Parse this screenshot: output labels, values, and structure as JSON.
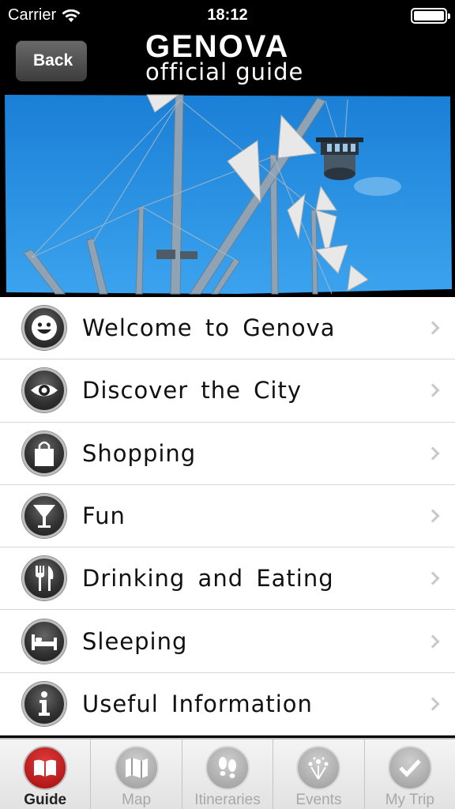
{
  "status_bar": {
    "carrier": "Carrier",
    "time": "18:12"
  },
  "nav": {
    "back_label": "Back",
    "brand_top": "GENOVA",
    "brand_bottom": "official guide"
  },
  "menu": {
    "items": [
      {
        "label": "Welcome to Genova",
        "icon": "smiley-icon"
      },
      {
        "label": "Discover the City",
        "icon": "eye-icon"
      },
      {
        "label": "Shopping",
        "icon": "shopping-bag-icon"
      },
      {
        "label": "Fun",
        "icon": "cocktail-glass-icon"
      },
      {
        "label": "Drinking and Eating",
        "icon": "fork-knife-icon"
      },
      {
        "label": "Sleeping",
        "icon": "bed-icon"
      },
      {
        "label": "Useful Information",
        "icon": "info-icon"
      }
    ]
  },
  "tabbar": {
    "tabs": [
      {
        "label": "Guide",
        "icon": "book-icon",
        "active": true
      },
      {
        "label": "Map",
        "icon": "map-icon",
        "active": false
      },
      {
        "label": "Itineraries",
        "icon": "footprints-icon",
        "active": false
      },
      {
        "label": "Events",
        "icon": "fireworks-icon",
        "active": false
      },
      {
        "label": "My Trip",
        "icon": "checkmark-icon",
        "active": false
      }
    ]
  },
  "colors": {
    "active_tab": "#c41a1a",
    "sky": "#1e8fe0"
  }
}
